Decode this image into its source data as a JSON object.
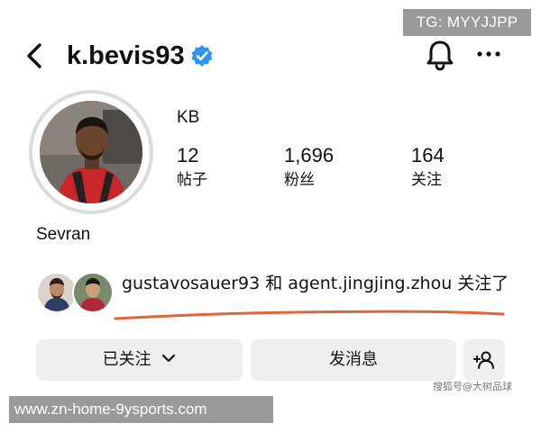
{
  "watermark": {
    "tg": "TG: MYYJJPP",
    "url": "www.zn-home-9ysports.com",
    "credit": "搜狐号@大树品球"
  },
  "header": {
    "username": "k.bevis93",
    "verified_icon": "verified-badge-icon",
    "icons": [
      "back-arrow-icon",
      "bell-icon",
      "more-icon"
    ]
  },
  "profile": {
    "display_name": "KB",
    "location": "Sevran",
    "stats": [
      {
        "value": "12",
        "label": "帖子"
      },
      {
        "value": "1,696",
        "label": "粉丝"
      },
      {
        "value": "164",
        "label": "关注"
      }
    ]
  },
  "mutuals": {
    "text": "gustavosauer93 和 agent.jingjing.zhou 关注了"
  },
  "actions": {
    "following_label": "已关注",
    "message_label": "发消息",
    "add_user_icon": "add-user-icon"
  },
  "colors": {
    "verified": "#2b95f2",
    "underline": "#e0663a",
    "button_bg": "#efefef",
    "watermark_bg": "#9a9a9a"
  }
}
